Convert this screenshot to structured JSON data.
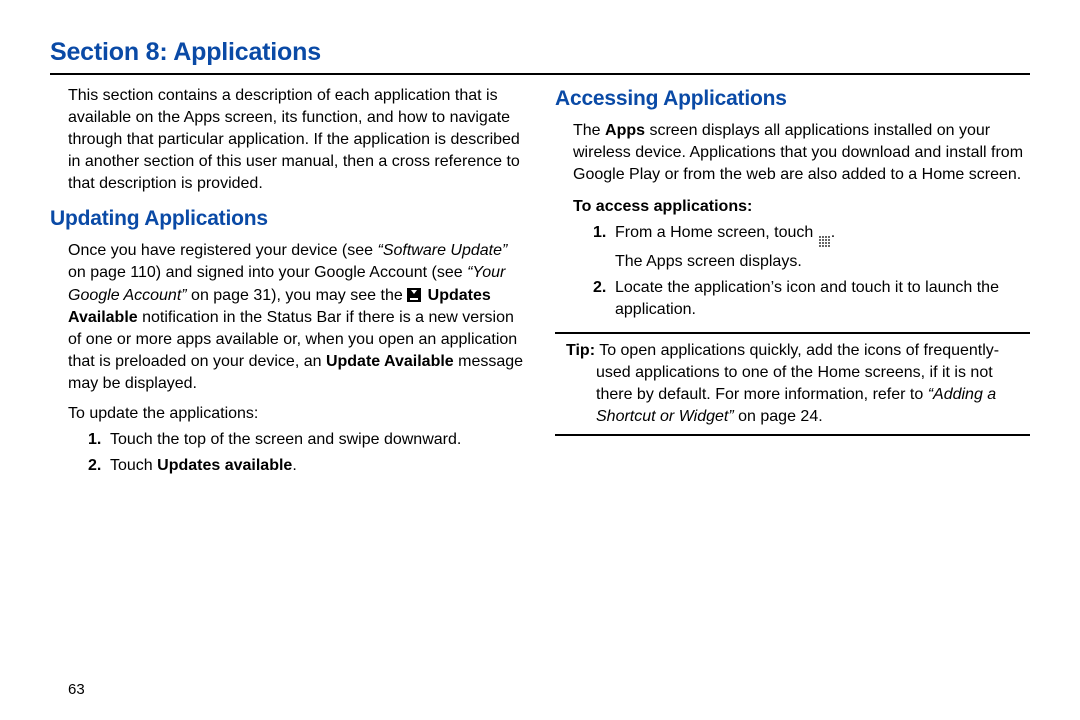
{
  "page_number": "63",
  "section_title": "Section 8: Applications",
  "left": {
    "intro": "This section contains a description of each application that is available on the Apps screen, its function, and how to navigate through that particular application. If the application is described in another section of this user manual, then a cross reference to that description is provided.",
    "heading_updating": "Updating Applications",
    "updating_p1_a": "Once you have registered your device (see ",
    "updating_xref1": "“Software Update”",
    "updating_p1_b": " on page 110) and signed into your Google Account (see ",
    "updating_xref2": "“Your Google Account”",
    "updating_p1_c": " on page 31), you may see the ",
    "updates_available_bold": "Updates Available",
    "updating_p1_d": " notification in the Status Bar if there is a new version of one or more apps available or, when you open an application that is preloaded on your device, an ",
    "update_available_bold": "Update Available",
    "updating_p1_e": " message may be displayed.",
    "to_update_label": "To update the applications:",
    "step1": "Touch the top of the screen and swipe downward.",
    "step2_a": "Touch ",
    "step2_bold": "Updates available",
    "step2_b": "."
  },
  "right": {
    "heading_accessing": "Accessing Applications",
    "accessing_p1_a": "The ",
    "apps_bold": "Apps",
    "accessing_p1_b": " screen displays all applications installed on your wireless device. Applications that you download and install from Google Play or from the web are also added to a Home screen.",
    "to_access_label": "To access applications:",
    "r_step1_a": "From a Home screen, touch ",
    "r_step1_b": ".",
    "r_step1_extra": "The Apps screen displays.",
    "r_step2": "Locate the application’s icon and touch it to launch the application.",
    "tip_label": "Tip:",
    "tip_body_a": " To open applications quickly, add the icons of frequently-used applications to one of the Home screens, if it is not there by default. For more information, refer to ",
    "tip_xref": "“Adding a Shortcut or Widget”",
    "tip_body_b": " on page 24."
  }
}
